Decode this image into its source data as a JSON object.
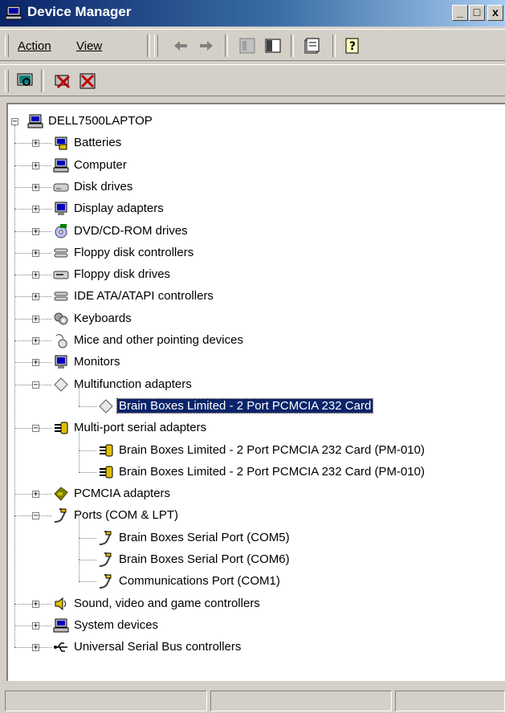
{
  "window": {
    "title": "Device Manager",
    "buttons": {
      "minimize": "_",
      "maximize": "□",
      "close": "x"
    }
  },
  "menu": {
    "action": "Action",
    "view": "View"
  },
  "toolbar": {
    "icons": [
      "back-arrow-icon",
      "forward-arrow-icon",
      "tree-view-icon",
      "show-hide-console-icon",
      "properties-icon",
      "help-icon"
    ]
  },
  "toolbar2": {
    "icons": [
      "scan-hardware-icon",
      "uninstall-icon",
      "disable-device-icon"
    ]
  },
  "tree": {
    "root": "DELL7500LAPTOP",
    "items": [
      {
        "label": "Batteries",
        "icon": "battery-icon"
      },
      {
        "label": "Computer",
        "icon": "computer-icon"
      },
      {
        "label": "Disk drives",
        "icon": "disk-drive-icon"
      },
      {
        "label": "Display adapters",
        "icon": "monitor-icon"
      },
      {
        "label": "DVD/CD-ROM drives",
        "icon": "cdrom-icon"
      },
      {
        "label": "Floppy disk controllers",
        "icon": "controller-icon"
      },
      {
        "label": "Floppy disk drives",
        "icon": "floppy-icon"
      },
      {
        "label": "IDE ATA/ATAPI controllers",
        "icon": "controller-icon"
      },
      {
        "label": "Keyboards",
        "icon": "keyboard-icon"
      },
      {
        "label": "Mice and other pointing devices",
        "icon": "mouse-icon"
      },
      {
        "label": "Monitors",
        "icon": "monitor-icon"
      },
      {
        "label": "Multifunction adapters",
        "icon": "multifunction-icon"
      },
      {
        "label": "Brain Boxes Limited - 2 Port PCMCIA 232 Card",
        "icon": "multifunction-icon"
      },
      {
        "label": "Multi-port serial adapters",
        "icon": "serial-adapter-icon"
      },
      {
        "label": "Brain Boxes Limited - 2 Port PCMCIA 232 Card (PM-010)",
        "icon": "serial-adapter-icon"
      },
      {
        "label": "Brain Boxes Limited - 2 Port PCMCIA 232 Card (PM-010)",
        "icon": "serial-adapter-icon"
      },
      {
        "label": "PCMCIA adapters",
        "icon": "pcmcia-icon"
      },
      {
        "label": "Ports (COM & LPT)",
        "icon": "port-icon"
      },
      {
        "label": "Brain Boxes Serial Port (COM5)",
        "icon": "port-icon"
      },
      {
        "label": "Brain Boxes Serial Port (COM6)",
        "icon": "port-icon"
      },
      {
        "label": "Communications Port (COM1)",
        "icon": "port-icon"
      },
      {
        "label": "Sound, video and game controllers",
        "icon": "speaker-icon"
      },
      {
        "label": "System devices",
        "icon": "computer-icon"
      },
      {
        "label": "Universal Serial Bus controllers",
        "icon": "usb-icon"
      }
    ],
    "expand": {
      "collapsed": "+",
      "expanded": "−"
    }
  },
  "colors": {
    "title_start": "#0a246a",
    "title_end": "#a6caf0",
    "selection": "#0a246a",
    "face": "#d4d0c8"
  }
}
